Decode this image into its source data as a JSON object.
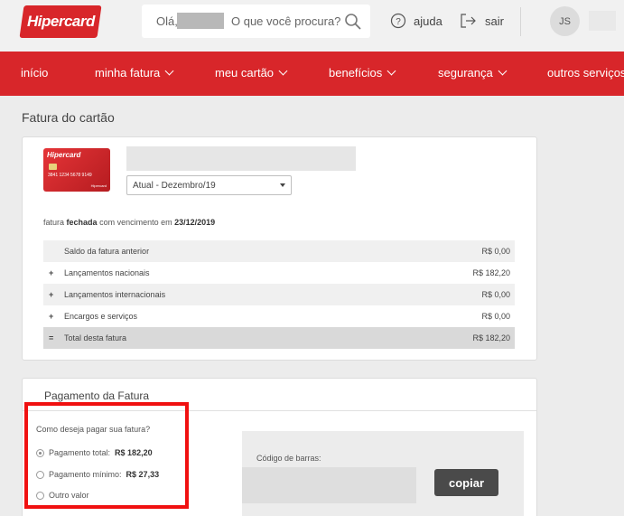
{
  "header": {
    "logo_text": "Hipercard",
    "search": {
      "greeting": "Olá,",
      "placeholder": "O que você procura?"
    },
    "help_label": "ajuda",
    "logout_label": "sair",
    "avatar_initials": "JS"
  },
  "nav": {
    "items": [
      {
        "label": "início",
        "chevron": false
      },
      {
        "label": "minha fatura",
        "chevron": true
      },
      {
        "label": "meu cartão",
        "chevron": true
      },
      {
        "label": "benefícios",
        "chevron": true
      },
      {
        "label": "segurança",
        "chevron": true
      },
      {
        "label": "outros serviços",
        "chevron": true
      }
    ]
  },
  "page_title": "Fatura do cartão",
  "invoice": {
    "card_image": {
      "brand": "Hipercard",
      "number": "3841 1234 5678 9149",
      "issuer": "Hipercard"
    },
    "period_select": "Atual - Dezembro/19",
    "status_prefix": "fatura",
    "status_word": "fechada",
    "due_text": "com vencimento em",
    "due_date": "23/12/2019",
    "rows": [
      {
        "symbol": "",
        "label": "Saldo da fatura anterior",
        "value": "R$ 0,00"
      },
      {
        "symbol": "+",
        "label": "Lançamentos nacionais",
        "value": "R$ 182,20"
      },
      {
        "symbol": "+",
        "label": "Lançamentos internacionais",
        "value": "R$ 0,00"
      },
      {
        "symbol": "+",
        "label": "Encargos e serviços",
        "value": "R$ 0,00"
      },
      {
        "symbol": "=",
        "label": "Total desta fatura",
        "value": "R$ 182,20"
      }
    ]
  },
  "payment": {
    "title": "Pagamento da Fatura",
    "question": "Como deseja pagar sua fatura?",
    "options": [
      {
        "label": "Pagamento total:",
        "amount": "R$ 182,20",
        "selected": true
      },
      {
        "label": "Pagamento mínimo:",
        "amount": "R$ 27,33",
        "selected": false
      },
      {
        "label": "Outro valor",
        "amount": "",
        "selected": false
      }
    ],
    "barcode_label": "Código de barras:",
    "copy_label": "copiar"
  },
  "colors": {
    "brand_red": "#d8262a",
    "highlight": "#f01010",
    "copy_button": "#4a4a4a"
  }
}
